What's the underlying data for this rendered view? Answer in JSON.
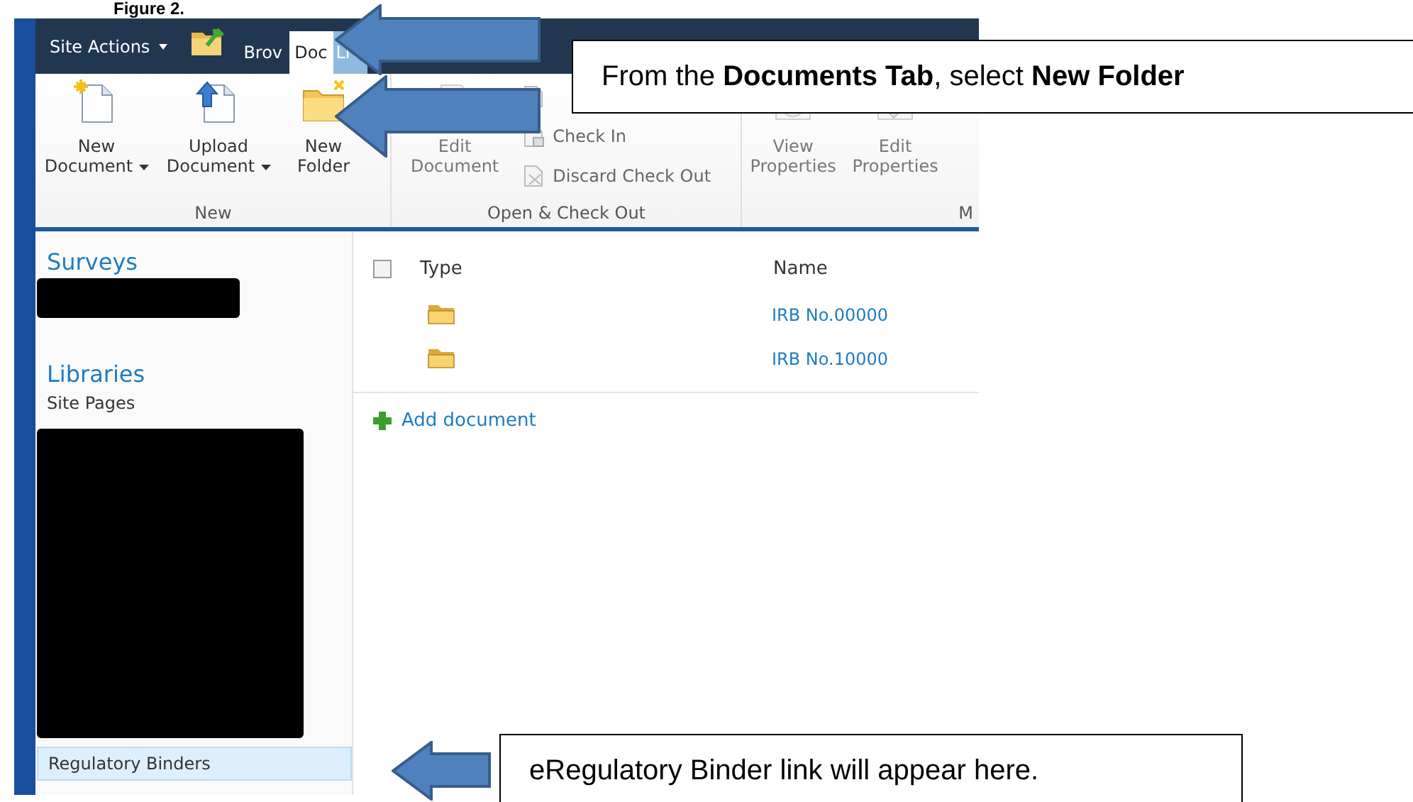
{
  "figure_title": "Figure 2.",
  "top_bar": {
    "site_actions": "Site Actions",
    "tabs": [
      {
        "label": "Brov",
        "selected": false
      },
      {
        "label": "Doc",
        "selected": true
      },
      {
        "label": "Li",
        "selected": false
      }
    ]
  },
  "ribbon": {
    "groups": [
      {
        "label": "New",
        "large": [
          {
            "label": "New Document",
            "kind": "new",
            "dropdown": true,
            "disabled": false
          },
          {
            "label": "Upload Document",
            "kind": "upload",
            "dropdown": true,
            "disabled": false
          },
          {
            "label": "New Folder",
            "kind": "folder",
            "dropdown": false,
            "disabled": false
          }
        ]
      },
      {
        "label": "Open & Check Out",
        "large": [
          {
            "label": "Edit Document",
            "kind": "edit",
            "dropdown": false,
            "disabled": true
          }
        ],
        "small": [
          {
            "kind": "checkout",
            "disabled": true
          },
          {
            "label": "Check In",
            "kind": "checkin",
            "disabled": true
          },
          {
            "label": "Discard Check Out",
            "kind": "discard",
            "disabled": true
          }
        ]
      },
      {
        "label": "M",
        "large": [
          {
            "label": "View Properties",
            "kind": "view",
            "dropdown": false,
            "disabled": true
          },
          {
            "label": "Edit Properties",
            "kind": "editprops",
            "dropdown": false,
            "disabled": true
          }
        ]
      }
    ]
  },
  "sidebar": {
    "sections": [
      {
        "heading": "Surveys",
        "items": [
          {
            "kind": "strip"
          }
        ]
      },
      {
        "heading": "Libraries",
        "items": [
          {
            "kind": "link",
            "label": "Site Pages",
            "selected": false
          },
          {
            "kind": "block"
          },
          {
            "kind": "link",
            "label": "Regulatory Binders",
            "selected": true
          }
        ]
      }
    ]
  },
  "table": {
    "select_all": {
      "checked": false
    },
    "columns": [
      "Type",
      "Name"
    ],
    "rows": [
      {
        "kind": "folder",
        "name": "IRB No.00000"
      },
      {
        "kind": "folder",
        "name": "IRB No.10000"
      }
    ],
    "add_link": "Add document"
  },
  "callouts": [
    {
      "text": "From the **Documents Tab**, select **New Folder**"
    },
    {
      "text": "eRegulatory Binder link will appear here."
    }
  ]
}
